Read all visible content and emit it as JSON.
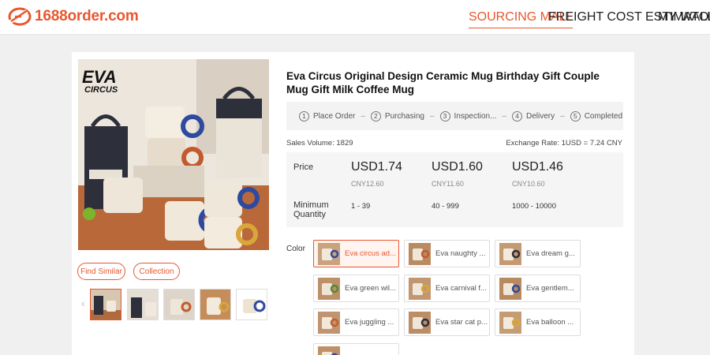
{
  "header": {
    "logo_text": "1688order.com",
    "nav": [
      {
        "label": "SOURCING MALL",
        "active": true
      },
      {
        "label": "FREIGHT COST ESTIMATOR",
        "active": false
      },
      {
        "label": "MY WALLET",
        "active": false
      }
    ]
  },
  "product": {
    "title": "Eva Circus Original Design Ceramic Mug Birthday Gift Couple Mug Gift Milk Coffee Mug",
    "image_brand": "EVA CIRCUS",
    "buttons": {
      "find_similar": "Find Similar",
      "collection": "Collection"
    },
    "thumbnail_count": 5,
    "selected_thumbnail": 0
  },
  "steps": [
    {
      "num": "1",
      "label": "Place Order"
    },
    {
      "num": "2",
      "label": "Purchasing"
    },
    {
      "num": "3",
      "label": "Inspection..."
    },
    {
      "num": "4",
      "label": "Delivery"
    },
    {
      "num": "5",
      "label": "Completed"
    }
  ],
  "step_separator": "–",
  "sales": {
    "label": "Sales Volume:",
    "value": "1829"
  },
  "exchange_rate": "Exchange Rate: 1USD = 7.24 CNY",
  "pricing": {
    "price_label": "Price",
    "qty_label": "Minimum Quantity",
    "tiers": [
      {
        "usd": "USD1.74",
        "cny": "CNY12.60",
        "qty": "1 - 39"
      },
      {
        "usd": "USD1.60",
        "cny": "CNY11.60",
        "qty": "40 - 999"
      },
      {
        "usd": "USD1.46",
        "cny": "CNY10.60",
        "qty": "1000 - 10000"
      }
    ]
  },
  "color": {
    "label": "Color",
    "variants": [
      {
        "label": "Eva circus ad...",
        "selected": true
      },
      {
        "label": "Eva naughty ...",
        "selected": false
      },
      {
        "label": "Eva dream g...",
        "selected": false
      },
      {
        "label": "Eva green wil...",
        "selected": false
      },
      {
        "label": "Eva carnival f...",
        "selected": false
      },
      {
        "label": "Eva gentlem...",
        "selected": false
      },
      {
        "label": "Eva juggling ...",
        "selected": false
      },
      {
        "label": "Eva star cat p...",
        "selected": false
      },
      {
        "label": "Eva balloon ...",
        "selected": false
      },
      {
        "label": "",
        "selected": false
      }
    ]
  },
  "colors": {
    "accent": "#e8572e",
    "page_bg": "#f0f0f0"
  }
}
